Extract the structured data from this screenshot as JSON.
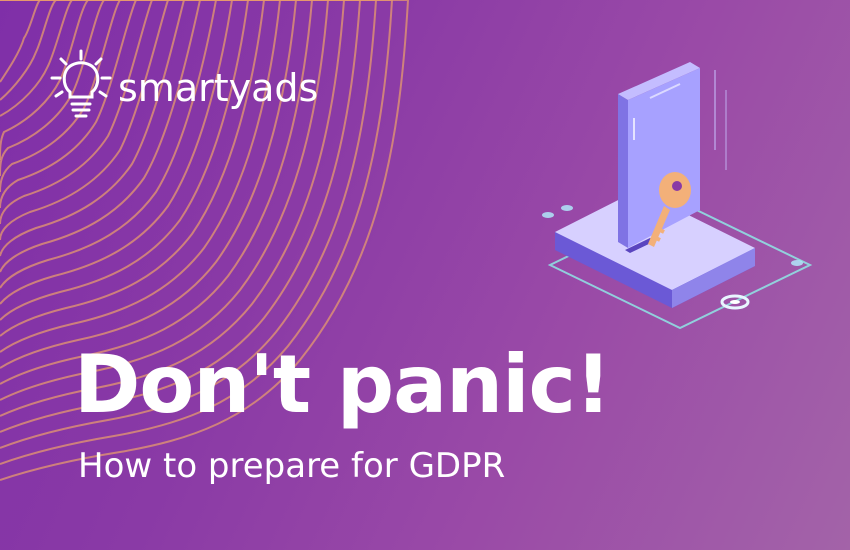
{
  "brand": {
    "name": "smartyads",
    "logo_icon": "lightbulb-icon"
  },
  "headline": "Don't panic!",
  "subheadline": "How to prepare for GDPR",
  "illustration": {
    "icons": [
      "smartphone-icon",
      "key-icon",
      "platform-icon"
    ]
  },
  "colors": {
    "background_start": "#7f2fa8",
    "background_end": "#a363a8",
    "contour_lines": "#e59a6e",
    "text": "#ffffff",
    "key": "#f3b079",
    "phone": "#a7a1ff"
  }
}
